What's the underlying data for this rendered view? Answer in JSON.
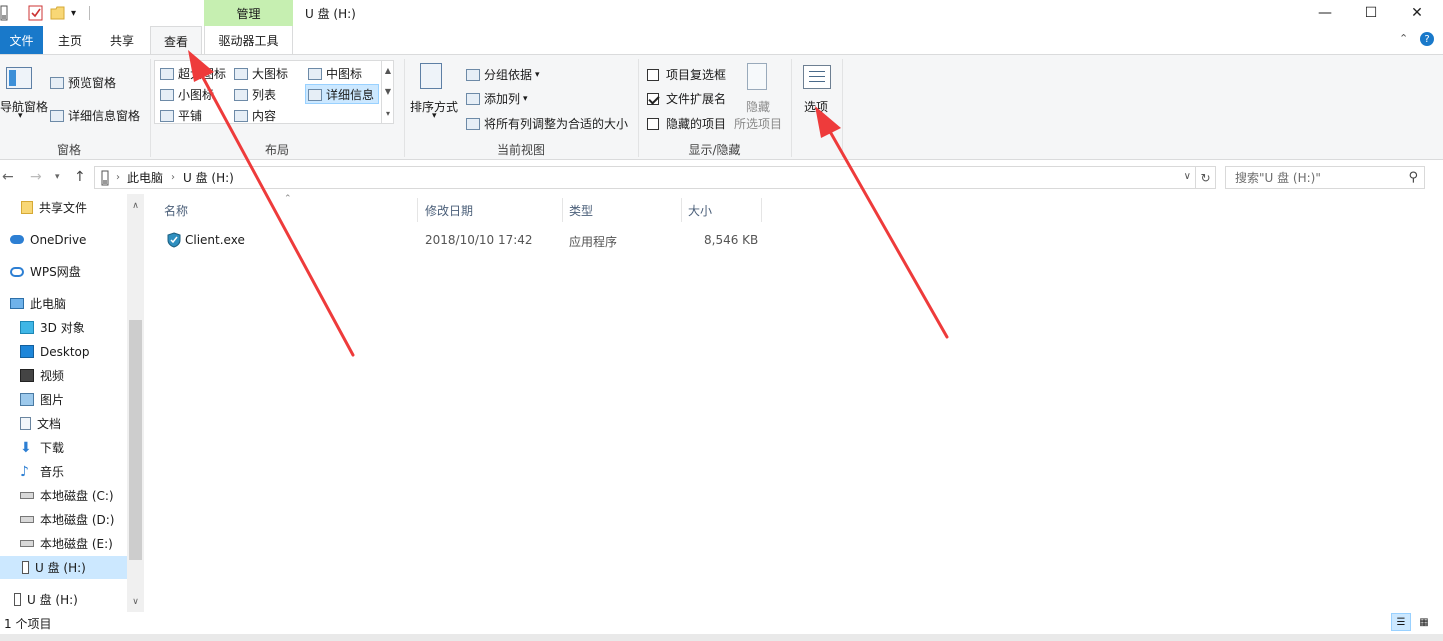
{
  "window": {
    "title": "U 盘 (H:)",
    "context_tab": "管理",
    "minimize_glyph": "—",
    "maximize_glyph": "☐",
    "close_glyph": "✕"
  },
  "tabs": {
    "file": "文件",
    "home": "主页",
    "share": "共享",
    "view": "查看",
    "drive_tools": "驱动器工具",
    "collapse_glyph": "⌃",
    "help_glyph": "?"
  },
  "ribbon": {
    "panes": {
      "nav_pane": "导航窗格",
      "preview_pane": "预览窗格",
      "details_pane": "详细信息窗格",
      "label": "窗格"
    },
    "layout": {
      "extra_large": "超大图标",
      "large": "大图标",
      "medium": "中图标",
      "small": "小图标",
      "list": "列表",
      "details": "详细信息",
      "tiles": "平铺",
      "content": "内容",
      "label": "布局"
    },
    "current_view": {
      "sort_by": "排序方式",
      "group_by": "分组依据",
      "add_column": "添加列",
      "fit_columns": "将所有列调整为合适的大小",
      "label": "当前视图"
    },
    "show_hide": {
      "item_checkboxes": "项目复选框",
      "item_checkboxes_checked": false,
      "file_extensions": "文件扩展名",
      "file_extensions_checked": true,
      "hidden_items": "隐藏的项目",
      "hidden_items_checked": false,
      "hide_selected_line1": "隐藏",
      "hide_selected_line2": "所选项目",
      "label": "显示/隐藏"
    },
    "options": "选项"
  },
  "address": {
    "crumb_1": "此电脑",
    "crumb_2": "U 盘 (H:)",
    "search_placeholder": "搜索\"U 盘 (H:)\""
  },
  "nav_items": [
    {
      "label": "共享文件"
    },
    {
      "label": "OneDrive"
    },
    {
      "label": "WPS网盘"
    },
    {
      "label": "此电脑"
    },
    {
      "label": "3D 对象"
    },
    {
      "label": "Desktop"
    },
    {
      "label": "视频"
    },
    {
      "label": "图片"
    },
    {
      "label": "文档"
    },
    {
      "label": "下载"
    },
    {
      "label": "音乐"
    },
    {
      "label": "本地磁盘 (C:)"
    },
    {
      "label": "本地磁盘 (D:)"
    },
    {
      "label": "本地磁盘 (E:)"
    },
    {
      "label": "U 盘 (H:)"
    },
    {
      "label": "U 盘 (H:)"
    }
  ],
  "columns": {
    "name": "名称",
    "modified": "修改日期",
    "type": "类型",
    "size": "大小"
  },
  "files": [
    {
      "name": "Client.exe",
      "modified": "2018/10/10 17:42",
      "type": "应用程序",
      "size": "8,546 KB"
    }
  ],
  "status": {
    "count": "1 个项目"
  },
  "colors": {
    "file_tab": "#1979ca",
    "manage_tab": "#c6efb1",
    "selection": "#cce8ff",
    "annotation_arrow": "#ee3b3b"
  }
}
